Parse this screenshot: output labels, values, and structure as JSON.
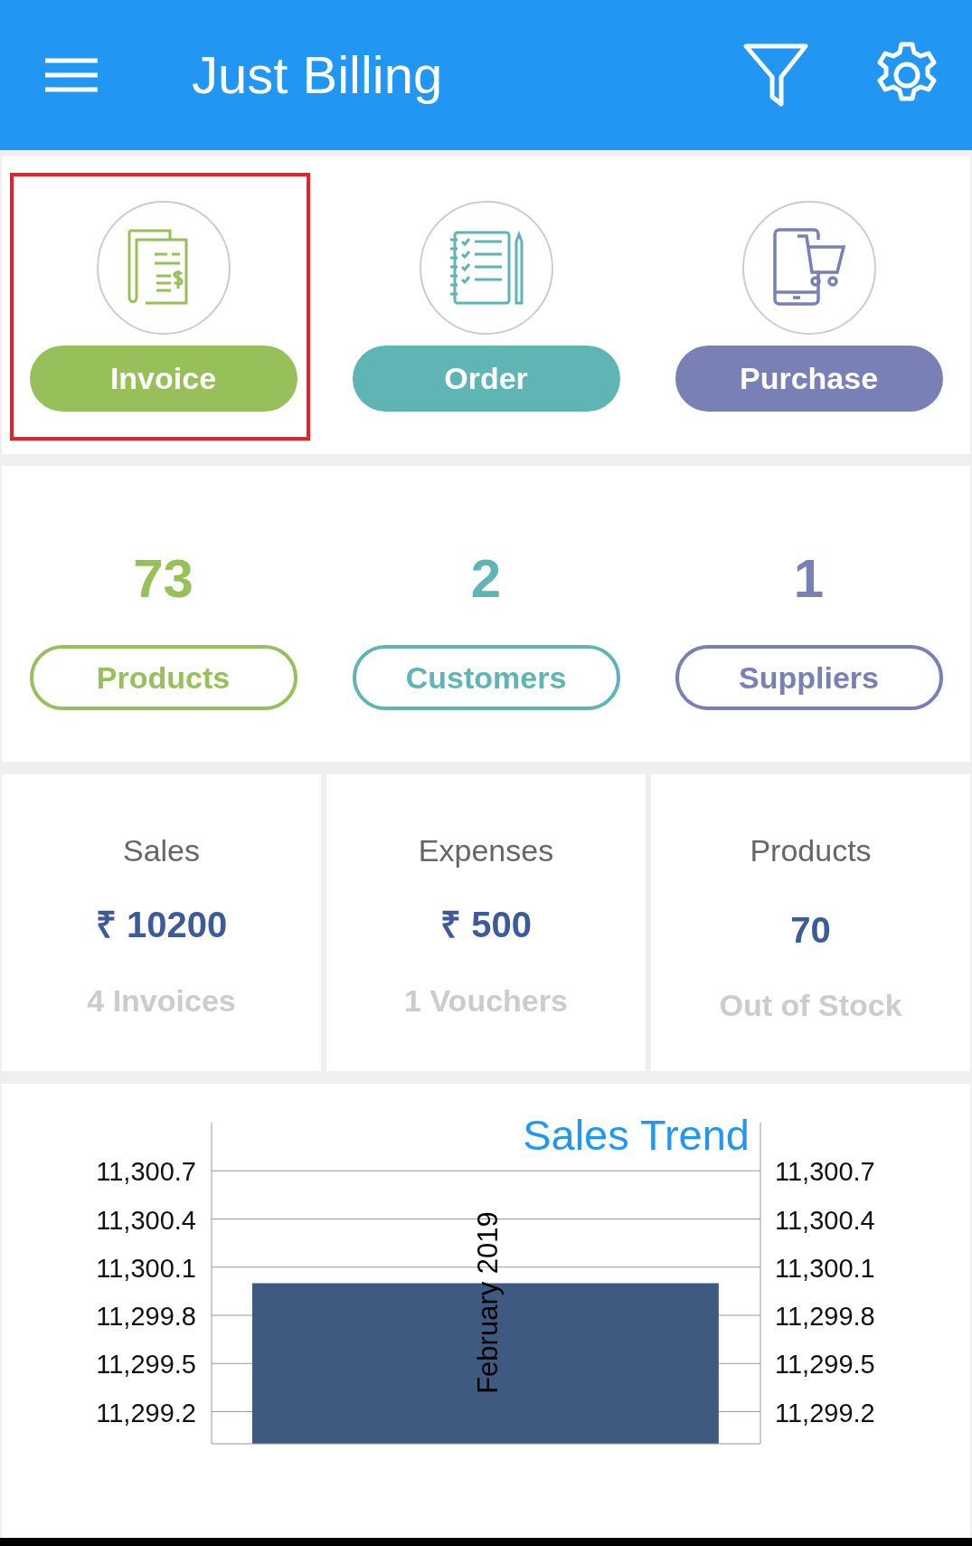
{
  "app_bar": {
    "title": "Just Billing"
  },
  "actions": [
    {
      "label": "Invoice",
      "kind": "invoice",
      "color": "#97bf5a",
      "highlighted": true
    },
    {
      "label": "Order",
      "kind": "order",
      "color": "#5fb4b4",
      "highlighted": false
    },
    {
      "label": "Purchase",
      "kind": "purchase",
      "color": "#7880b5",
      "highlighted": false
    }
  ],
  "counts": [
    {
      "value": "73",
      "label": "Products",
      "color": "#97bf5a"
    },
    {
      "value": "2",
      "label": "Customers",
      "color": "#5fb4b4"
    },
    {
      "value": "1",
      "label": "Suppliers",
      "color": "#7880b5"
    }
  ],
  "summaries": [
    {
      "title": "Sales",
      "value": "₹ 10200",
      "note": "4 Invoices"
    },
    {
      "title": "Expenses",
      "value": "₹ 500",
      "note": "1 Vouchers"
    },
    {
      "title": "Products",
      "value": "70",
      "note": "Out of Stock"
    }
  ],
  "chart_panel": {
    "chart_data": {
      "type": "bar",
      "title": "Sales Trend",
      "categories": [
        "February 2019"
      ],
      "series": [
        {
          "color": "#3f5a80",
          "values": [
            11300.0
          ]
        }
      ],
      "grid": true,
      "ylim": [
        11299.0,
        11301.0
      ],
      "yticks": [
        {
          "value": 11299.2,
          "label": "11,299.2"
        },
        {
          "value": 11299.5,
          "label": "11,299.5"
        },
        {
          "value": 11299.8,
          "label": "11,299.8"
        },
        {
          "value": 11300.1,
          "label": "11,300.1"
        },
        {
          "value": 11300.4,
          "label": "11,300.4"
        },
        {
          "value": 11300.7,
          "label": "11,300.7"
        }
      ]
    }
  }
}
